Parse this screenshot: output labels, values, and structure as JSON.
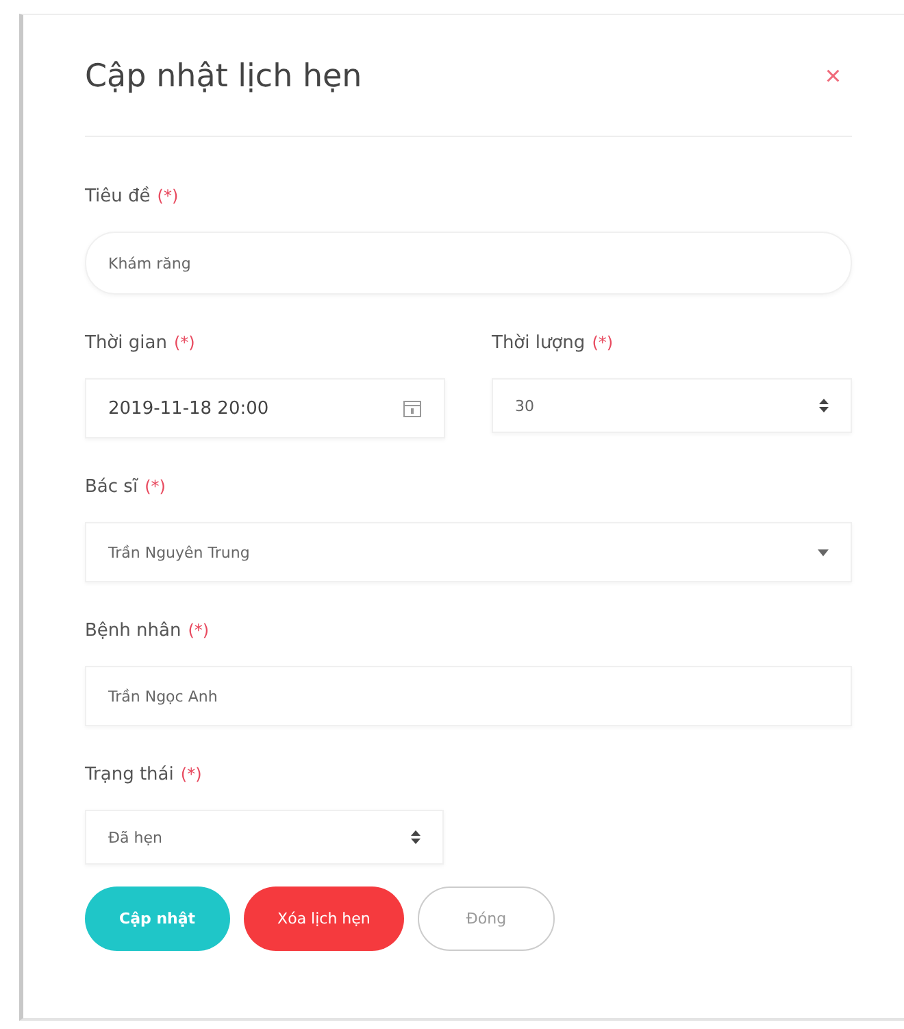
{
  "dialog": {
    "title": "Cập nhật lịch hẹn",
    "close": "×"
  },
  "rows": [
    {
      "fields": [
        {
          "label": "Tiêu đề",
          "required": true,
          "required_mark": "(*)",
          "kind": "pill",
          "value": "Khám răng"
        }
      ]
    },
    {
      "fields": [
        {
          "label": "Thời gian",
          "required": true,
          "required_mark": "(*)",
          "kind": "datetime",
          "value": "2019-11-18 20:00"
        },
        {
          "label": "Thời lượng",
          "required": true,
          "required_mark": "(*)",
          "kind": "spinner",
          "value": "30"
        }
      ]
    },
    {
      "fields": [
        {
          "label": "Bác sĩ",
          "required": true,
          "required_mark": "(*)",
          "kind": "dropdown",
          "value": "Trần Nguyên Trung"
        }
      ]
    },
    {
      "fields": [
        {
          "label": "Bệnh nhân",
          "required": true,
          "required_mark": "(*)",
          "kind": "text",
          "value": "Trần Ngọc Anh"
        }
      ]
    },
    {
      "fields": [
        {
          "label": "Trạng thái",
          "required": true,
          "required_mark": "(*)",
          "kind": "spinner",
          "half": true,
          "value": "Đã hẹn"
        }
      ]
    }
  ],
  "buttons": [
    {
      "label": "Cập nhật",
      "kind": "primary"
    },
    {
      "label": "Xóa lịch hẹn",
      "kind": "danger"
    },
    {
      "label": "Đóng",
      "kind": "outline"
    }
  ]
}
